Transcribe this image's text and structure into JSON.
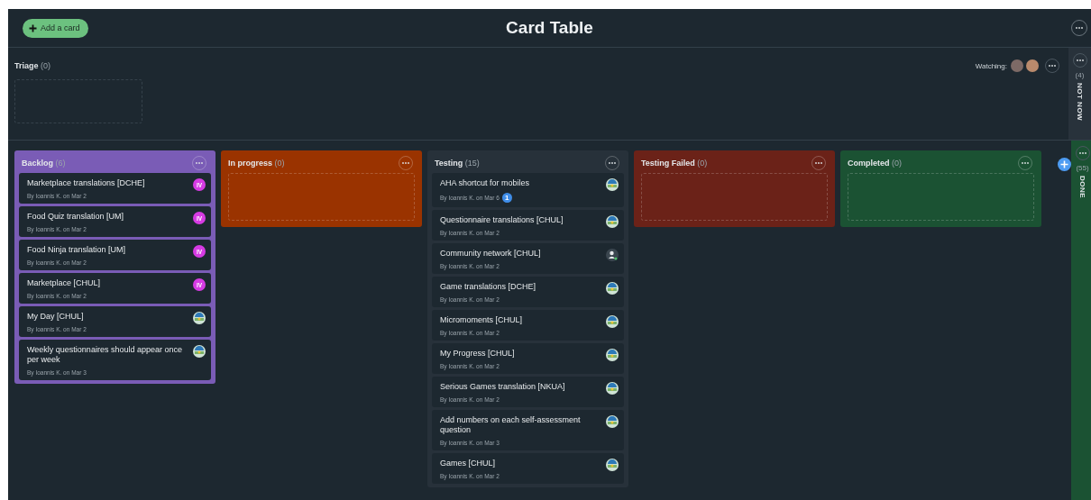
{
  "header": {
    "add_button": "Add a card",
    "title": "Card Table"
  },
  "triage": {
    "title": "Triage",
    "count": "(0)",
    "watching_label": "Watching:"
  },
  "not_now": {
    "count": "(4)",
    "label": "NOT NOW",
    "color": "#28323b"
  },
  "columns": [
    {
      "title": "Backlog",
      "count": "(6)",
      "color": "#7a5cb6",
      "cards": [
        {
          "title": "Marketplace translations [DCHE]",
          "meta": "By Ioannis K. on Mar 2",
          "avatar": {
            "kind": "initials",
            "text": "IV",
            "color": "#d63be3"
          }
        },
        {
          "title": "Food Quiz translation [UM]",
          "meta": "By Ioannis K. on Mar 2",
          "avatar": {
            "kind": "initials",
            "text": "IV",
            "color": "#d63be3"
          }
        },
        {
          "title": "Food Ninja translation [UM]",
          "meta": "By Ioannis K. on Mar 2",
          "avatar": {
            "kind": "initials",
            "text": "IV",
            "color": "#d63be3"
          }
        },
        {
          "title": "Marketplace [CHUL]",
          "meta": "By Ioannis K. on Mar 2",
          "avatar": {
            "kind": "initials",
            "text": "IV",
            "color": "#d63be3"
          }
        },
        {
          "title": "My Day [CHUL]",
          "meta": "By Ioannis K. on Mar 2",
          "avatar": {
            "kind": "logo"
          }
        },
        {
          "title": "Weekly questionnaires should appear once per week",
          "meta": "By Ioannis K. on Mar 3",
          "avatar": {
            "kind": "logo"
          }
        }
      ]
    },
    {
      "title": "In progress",
      "count": "(0)",
      "color": "#9a3300"
    },
    {
      "title": "Testing",
      "count": "(15)",
      "color": "#27313a",
      "cards": [
        {
          "title": "AHA shortcut for mobiles",
          "meta": "By Ioannis K. on Mar 6",
          "badge": "1",
          "avatar": {
            "kind": "logo"
          }
        },
        {
          "title": "Questionnaire translations [CHUL]",
          "meta": "By Ioannis K. on Mar 2",
          "avatar": {
            "kind": "logo"
          }
        },
        {
          "title": "Community network [CHUL]",
          "meta": "By Ioannis K. on Mar 2",
          "avatar": {
            "kind": "person"
          }
        },
        {
          "title": "Game translations [DCHE]",
          "meta": "By Ioannis K. on Mar 2",
          "avatar": {
            "kind": "logo"
          }
        },
        {
          "title": "Micromoments [CHUL]",
          "meta": "By Ioannis K. on Mar 2",
          "avatar": {
            "kind": "logo"
          }
        },
        {
          "title": "My Progress [CHUL]",
          "meta": "By Ioannis K. on Mar 2",
          "avatar": {
            "kind": "logo"
          }
        },
        {
          "title": "Serious Games translation [NKUA]",
          "meta": "By Ioannis K. on Mar 2",
          "avatar": {
            "kind": "logo"
          }
        },
        {
          "title": "Add numbers on each self-assessment question",
          "meta": "By Ioannis K. on Mar 3",
          "avatar": {
            "kind": "logo"
          }
        },
        {
          "title": "Games [CHUL]",
          "meta": "By Ioannis K. on Mar 2",
          "avatar": {
            "kind": "logo"
          }
        }
      ]
    },
    {
      "title": "Testing Failed",
      "count": "(0)",
      "color": "#6b2218"
    },
    {
      "title": "Completed",
      "count": "(0)",
      "color": "#1b5233"
    }
  ],
  "done": {
    "count": "(55)",
    "label": "DONE",
    "color": "#1b5233"
  }
}
